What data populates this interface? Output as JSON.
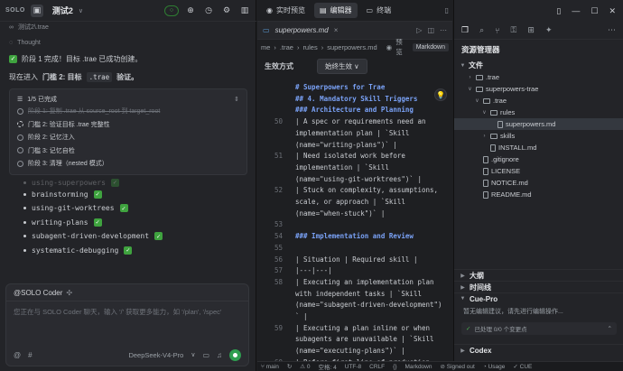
{
  "left": {
    "solo_badge": "SOLO",
    "tab_title": "测试2",
    "tab_chevron": "∨",
    "status_badge": "○",
    "thought_ref": "测试2\\.trae",
    "thought_label": "Thought",
    "msg_stage1": "阶段 1 完成！目标 .trae 已成功创建。",
    "msg_enter_a": "现在进入 ",
    "msg_enter_b": "门槛 2: 目标 ",
    "msg_enter_code": ".trae",
    "msg_enter_c": " 验证。",
    "todo_header": "1/5 已完成",
    "todos": [
      {
        "text": "阶段 1: 复制 .trae 从 source_root 到 target_root",
        "state": "done"
      },
      {
        "text": "门槛 2: 验证目标 .trae 完整性",
        "state": "progress"
      },
      {
        "text": "阶段 2: 记忆注入",
        "state": "pending"
      },
      {
        "text": "门槛 3: 记忆自检",
        "state": "pending"
      },
      {
        "text": "阶段 3: 清理（nested 模式）",
        "state": "pending"
      }
    ],
    "faded_line": "using-superpowers",
    "skills": [
      "brainstorming",
      "using-git-worktrees",
      "writing-plans",
      "subagent-driven-development",
      "systematic-debugging"
    ],
    "composer_head": "@SOLO Coder",
    "composer_placeholder": "您正在与 SOLO Coder 聊天，输入 '/' 获取更多能力，如 '/plan', '/spec'",
    "model_name": "DeepSeek-V4-Pro",
    "model_chevron": "∨"
  },
  "editor": {
    "btn_realtime": "实时预览",
    "btn_editor": "编辑器",
    "btn_terminal": "终端",
    "file_tab": "superpowers.md",
    "crumbs": [
      "me",
      ".trae",
      "rules",
      "superpowers.md",
      "预览"
    ],
    "markdown_btn": "Markdown",
    "effect_label": "生效方式",
    "effect_value": "始终生效",
    "sticky": [
      "# Superpowers for Trae",
      "## 4. Mandatory Skill Triggers",
      "### Architecture and Planning"
    ],
    "lines": [
      {
        "n": "50",
        "t": [
          "| A spec or requirements need an",
          "implementation plan | `Skill",
          "(name=\"writing-plans\")` |"
        ]
      },
      {
        "n": "51",
        "t": [
          "| Need isolated work before",
          "implementation | `Skill",
          "(name=\"using-git-worktrees\")` |"
        ]
      },
      {
        "n": "52",
        "t": [
          "| Stuck on complexity, assumptions,",
          "scale, or approach | `Skill",
          "(name=\"when-stuck\")` |"
        ]
      },
      {
        "n": "53",
        "t": [
          ""
        ]
      },
      {
        "n": "54",
        "t": [
          "### Implementation and Review"
        ],
        "head": true
      },
      {
        "n": "55",
        "t": [
          ""
        ]
      },
      {
        "n": "56",
        "t": [
          "| Situation | Required skill |"
        ]
      },
      {
        "n": "57",
        "t": [
          "|---|---|"
        ]
      },
      {
        "n": "58",
        "t": [
          "| Executing an implementation plan",
          "with independent tasks | `Skill",
          "(name=\"subagent-driven-development\")",
          "` |"
        ]
      },
      {
        "n": "59",
        "t": [
          "| Executing a plan inline or when",
          "subagents are unavailable | `Skill",
          "(name=\"executing-plans\")` |"
        ]
      },
      {
        "n": "60",
        "t": [
          "| Before first line of production"
        ]
      }
    ]
  },
  "explorer": {
    "title": "资源管理器",
    "files_label": "文件",
    "tree": [
      {
        "label": ".trae",
        "depth": 1,
        "kind": "folder",
        "open": false
      },
      {
        "label": "superpowers-trae",
        "depth": 1,
        "kind": "folder",
        "open": true
      },
      {
        "label": ".trae",
        "depth": 2,
        "kind": "folder",
        "open": true
      },
      {
        "label": "rules",
        "depth": 3,
        "kind": "folder",
        "open": true
      },
      {
        "label": "superpowers.md",
        "depth": 4,
        "kind": "file",
        "selected": true
      },
      {
        "label": "skills",
        "depth": 3,
        "kind": "folder",
        "open": false
      },
      {
        "label": "INSTALL.md",
        "depth": 3,
        "kind": "file"
      },
      {
        "label": ".gitignore",
        "depth": 2,
        "kind": "file"
      },
      {
        "label": "LICENSE",
        "depth": 2,
        "kind": "file"
      },
      {
        "label": "NOTICE.md",
        "depth": 2,
        "kind": "file"
      },
      {
        "label": "README.md",
        "depth": 2,
        "kind": "file"
      }
    ],
    "outline_label": "大纲",
    "timeline_label": "时间线",
    "cue_label": "Cue-Pro",
    "cue_text": "暂无编辑建议，请先进行编辑操作...",
    "cue_status": "已处理 0/0 个变更点",
    "codex_label": "Codex"
  },
  "status": {
    "branch": "main",
    "sync": "↻",
    "warnings": "⚠ 0",
    "spaces": "空格: 4",
    "encoding": "UTF-8",
    "eol": "CRLF",
    "lang": "Markdown",
    "signed": "Signed out",
    "usage": "Usage",
    "cue": "CUE"
  }
}
